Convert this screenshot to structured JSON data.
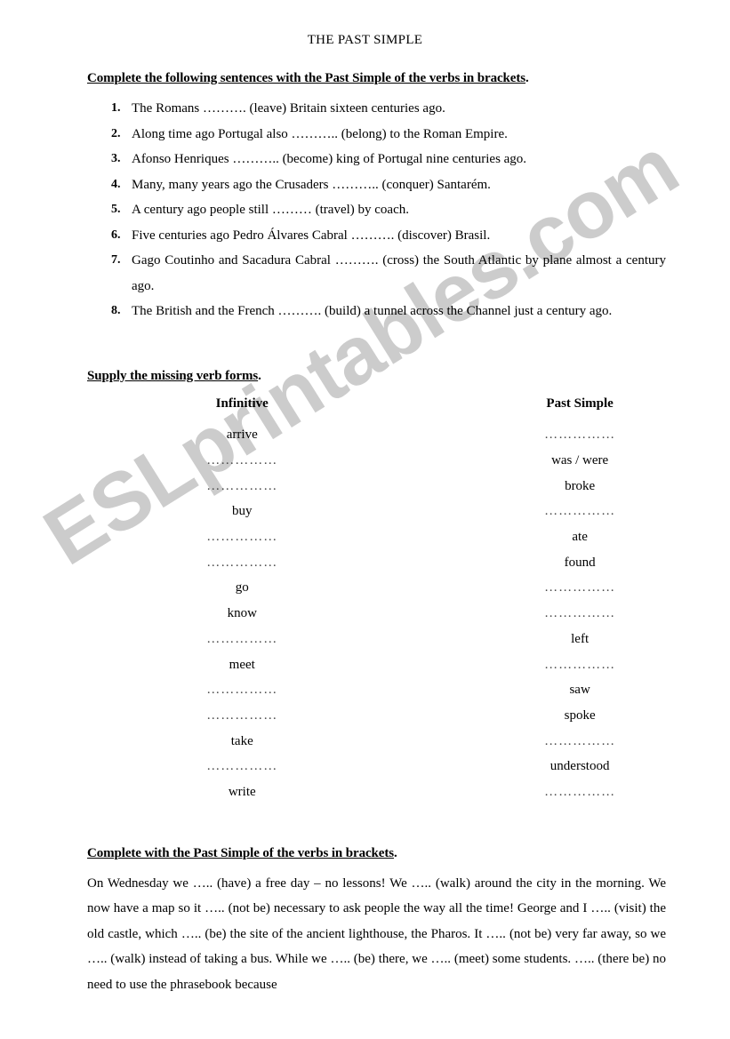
{
  "document": {
    "title": "THE PAST SIMPLE",
    "watermark": "ESLprintables.com",
    "watermark_color": "#cccccc"
  },
  "exercise1": {
    "heading": "Complete the following sentences with the Past Simple of the verbs in brackets",
    "heading_period": ".",
    "items": [
      {
        "num": "1.",
        "text": "The Romans ………. (leave) Britain sixteen centuries ago."
      },
      {
        "num": "2.",
        "text": "Along time ago Portugal also ……….. (belong) to the Roman Empire."
      },
      {
        "num": "3.",
        "text": "Afonso Henriques ……….. (become) king of Portugal nine centuries ago."
      },
      {
        "num": "4.",
        "text": "Many, many years ago the Crusaders ……….. (conquer) Santarém."
      },
      {
        "num": "5.",
        "text": "A century ago people still ……… (travel) by coach."
      },
      {
        "num": "6.",
        "text": "Five centuries ago Pedro Álvares Cabral ………. (discover) Brasil."
      },
      {
        "num": "7.",
        "text": "Gago Coutinho and Sacadura Cabral ………. (cross) the South Atlantic by plane almost a century ago."
      },
      {
        "num": "8.",
        "text": "The British and the French ………. (build) a tunnel across the Channel just a century ago."
      }
    ]
  },
  "exercise2": {
    "heading": "Supply the missing verb forms",
    "heading_period": ".",
    "columns": {
      "infinitive": "Infinitive",
      "past_simple": "Past Simple"
    },
    "blank": "……………",
    "rows": [
      {
        "infinitive": "arrive",
        "past_simple": "……………"
      },
      {
        "infinitive": "……………",
        "past_simple": "was / were"
      },
      {
        "infinitive": "……………",
        "past_simple": "broke"
      },
      {
        "infinitive": "buy",
        "past_simple": "……………"
      },
      {
        "infinitive": "……………",
        "past_simple": "ate"
      },
      {
        "infinitive": "……………",
        "past_simple": "found"
      },
      {
        "infinitive": "go",
        "past_simple": "……………"
      },
      {
        "infinitive": "know",
        "past_simple": "……………"
      },
      {
        "infinitive": "……………",
        "past_simple": "left"
      },
      {
        "infinitive": "meet",
        "past_simple": "……………"
      },
      {
        "infinitive": "……………",
        "past_simple": "saw"
      },
      {
        "infinitive": "……………",
        "past_simple": "spoke"
      },
      {
        "infinitive": "take",
        "past_simple": "……………"
      },
      {
        "infinitive": "……………",
        "past_simple": "understood"
      },
      {
        "infinitive": "write",
        "past_simple": "……………"
      }
    ]
  },
  "exercise3": {
    "heading": "Complete with the Past Simple of the verbs in brackets",
    "heading_period": ".",
    "text": "On Wednesday we ….. (have) a free day – no lessons! We ….. (walk) around the city in the morning. We now have a map so it ….. (not be) necessary to ask people the way all the time! George and I ….. (visit) the old castle, which ….. (be) the site of the ancient lighthouse, the Pharos. It ….. (not be) very far away, so we ….. (walk) instead of taking a bus. While we ….. (be) there, we ….. (meet) some students. ….. (there be) no need to use the phrasebook because"
  }
}
